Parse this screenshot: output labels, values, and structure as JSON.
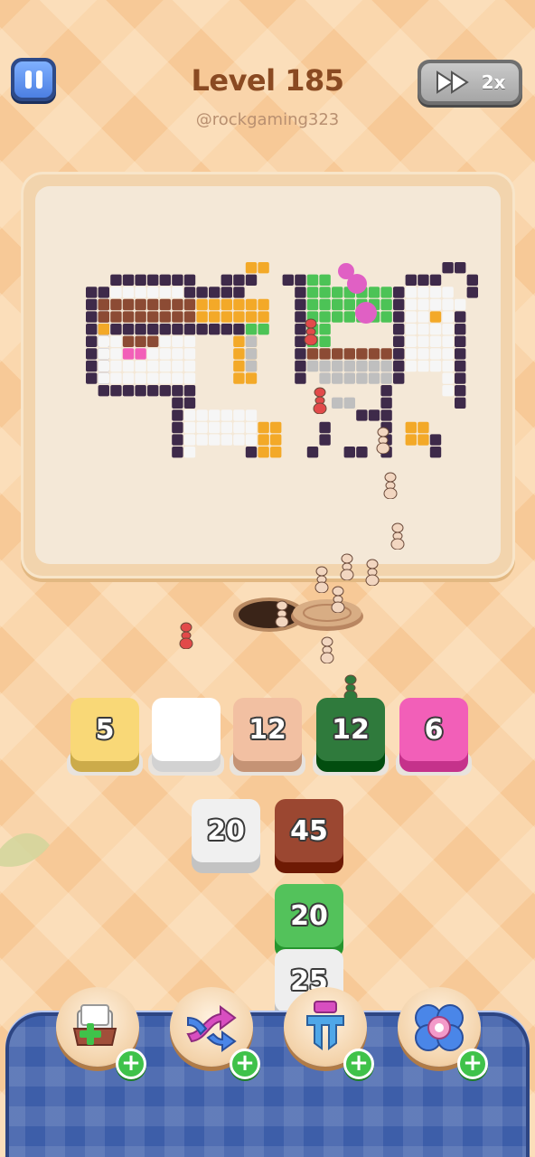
{
  "header": {
    "level_title": "Level 185",
    "username": "@rockgaming323",
    "speed_label": "2x"
  },
  "tiles": {
    "slots": [
      {
        "value": "5",
        "color": "#f9d877"
      },
      {
        "value": "",
        "color": "#ffffff"
      },
      {
        "value": "12",
        "color": "#f2c0a2"
      },
      {
        "value": "12",
        "color": "#2f7a3c"
      },
      {
        "value": "6",
        "color": "#f25fb8"
      }
    ],
    "stack_left": {
      "value": "20",
      "color": "#f0f0f0"
    },
    "stack_right": [
      {
        "value": "45",
        "color": "#9b4731"
      },
      {
        "value": "20",
        "color": "#53c25b"
      },
      {
        "value": "25",
        "color": "#eeeeee"
      }
    ]
  },
  "boosters": [
    {
      "name": "add-slot",
      "icon": "tray-plus-icon"
    },
    {
      "name": "shuffle",
      "icon": "shuffle-arrows-icon"
    },
    {
      "name": "magnet",
      "icon": "magnet-claw-icon"
    },
    {
      "name": "freeze",
      "icon": "flower-gear-icon"
    }
  ],
  "colors": {
    "outline": "#3e2a4a",
    "brown": "#8c4b34",
    "orange": "#f3a928",
    "white": "#f6f6f6",
    "green": "#4cc356",
    "pink": "#f25fb8",
    "grey": "#bfbfbf"
  }
}
